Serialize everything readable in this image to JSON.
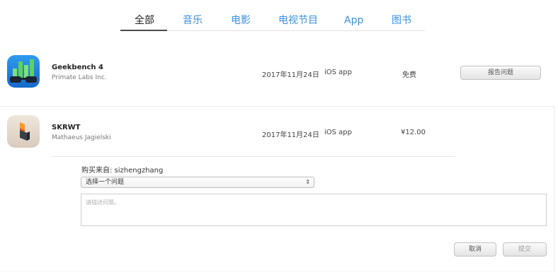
{
  "tabs": [
    {
      "label": "全部",
      "active": true
    },
    {
      "label": "音乐",
      "active": false
    },
    {
      "label": "电影",
      "active": false
    },
    {
      "label": "电视节目",
      "active": false
    },
    {
      "label": "App",
      "active": false
    },
    {
      "label": "图书",
      "active": false
    }
  ],
  "rows": [
    {
      "name": "Geekbench 4",
      "developer": "Primate Labs Inc.",
      "date": "2017年11月24日",
      "kind": "iOS app",
      "price": "免费",
      "action_label": "报告问题",
      "icon": "geekbench-icon"
    },
    {
      "name": "SKRWT",
      "developer": "Mathaeus Jagielski",
      "date": "2017年11月24日",
      "kind": "iOS app",
      "price": "¥12.00",
      "icon": "skrwt-icon"
    }
  ],
  "report_form": {
    "purchased_from": "购买来自: sizhengzhang",
    "issue_select_value": "选择一个问题",
    "description_placeholder": "请描述问题。",
    "cancel_label": "取消",
    "submit_label": "提交"
  },
  "colors": {
    "tab_link": "#3b8fe0",
    "tab_active": "#222222",
    "geekbench_blue": "#1e88e5",
    "skrwt_bg": "#e8ded3"
  }
}
